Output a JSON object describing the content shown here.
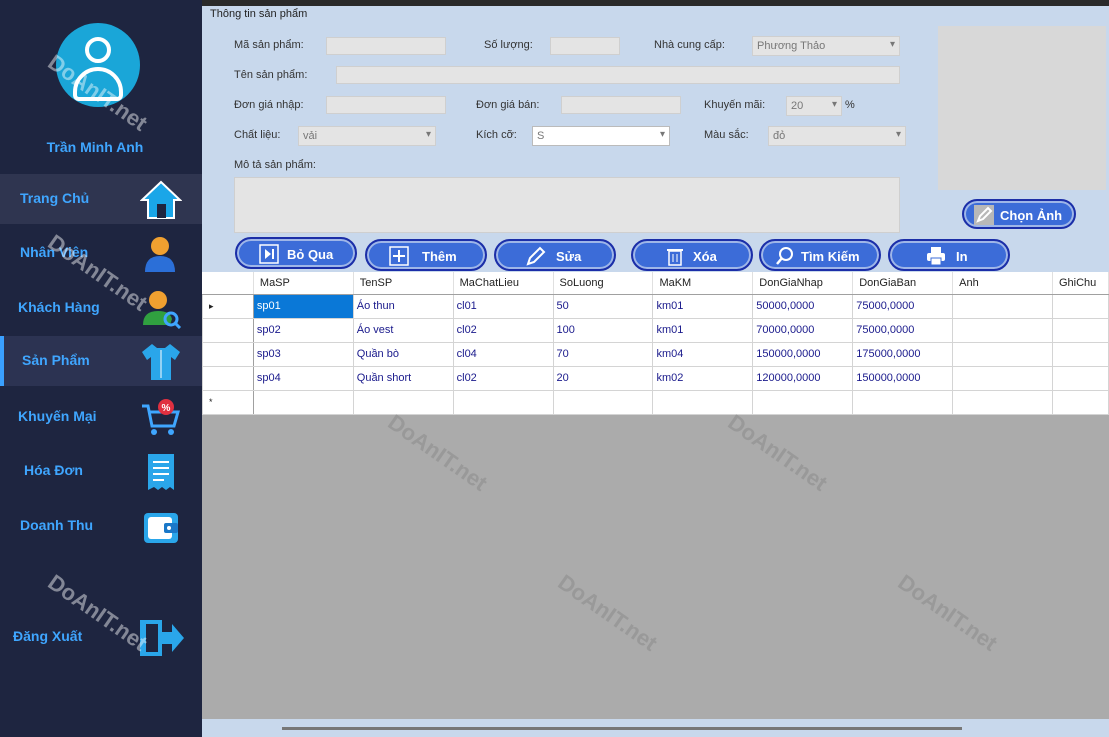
{
  "user": {
    "name": "Trần Minh Anh"
  },
  "nav": [
    {
      "label": "Trang Chủ",
      "icon": "home-icon"
    },
    {
      "label": "Nhân Viên",
      "icon": "employee-icon"
    },
    {
      "label": "Khách Hàng",
      "icon": "customer-search-icon"
    },
    {
      "label": "Sản Phẩm",
      "icon": "shirt-icon"
    },
    {
      "label": "Khuyến Mại",
      "icon": "cart-discount-icon"
    },
    {
      "label": "Hóa Đơn",
      "icon": "receipt-icon"
    },
    {
      "label": "Doanh Thu",
      "icon": "wallet-icon"
    },
    {
      "label": "Đăng Xuất",
      "icon": "logout-icon"
    }
  ],
  "form": {
    "title": "Thông tin sản phẩm",
    "ma_sp_label": "Mã sản phẩm:",
    "so_luong_label": "Số lượng:",
    "nha_cung_cap_label": "Nhà cung cấp:",
    "nha_cung_cap_value": "Phương Thảo",
    "ten_sp_label": "Tên sản phẩm:",
    "don_gia_nhap_label": "Đơn giá nhập:",
    "don_gia_ban_label": "Đơn giá bán:",
    "khuyen_mai_label": "Khuyến mãi:",
    "khuyen_mai_value": "20",
    "percent": "%",
    "chat_lieu_label": "Chất liệu:",
    "chat_lieu_value": "vải",
    "kich_co_label": "Kích cỡ:",
    "kich_co_value": "S",
    "mau_sac_label": "Màu sắc:",
    "mau_sac_value": "đỏ",
    "mo_ta_label": "Mô tả sản phẩm:",
    "chon_anh": "Chọn Ảnh"
  },
  "toolbar": {
    "bo_qua": "Bỏ Qua",
    "them": "Thêm",
    "sua": "Sửa",
    "xoa": "Xóa",
    "tim_kiem": "Tìm Kiếm",
    "in": "In"
  },
  "grid": {
    "columns": [
      "MaSP",
      "TenSP",
      "MaChatLieu",
      "SoLuong",
      "MaKM",
      "DonGiaNhap",
      "DonGiaBan",
      "Anh",
      "GhiChu"
    ],
    "rows": [
      [
        "sp01",
        "Áo thun",
        "cl01",
        "50",
        "km01",
        "50000,0000",
        "75000,0000",
        "",
        ""
      ],
      [
        "sp02",
        "Áo vest",
        "cl02",
        "100",
        "km01",
        "70000,0000",
        "75000,0000",
        "",
        ""
      ],
      [
        "sp03",
        "Quần bò",
        "cl04",
        "70",
        "km04",
        "150000,0000",
        "175000,0000",
        "",
        ""
      ],
      [
        "sp04",
        "Quần short",
        "cl02",
        "20",
        "km02",
        "120000,0000",
        "150000,0000",
        "",
        ""
      ]
    ],
    "current_row_marker": "▸",
    "new_row_marker": "*"
  },
  "watermark": "DoAnIT.net",
  "colors": {
    "sidebar": "#1e2540",
    "accent": "#3fa6ff",
    "button": "#3c6cd8",
    "panel": "#c8d8ec",
    "selection": "#0a78d7"
  }
}
